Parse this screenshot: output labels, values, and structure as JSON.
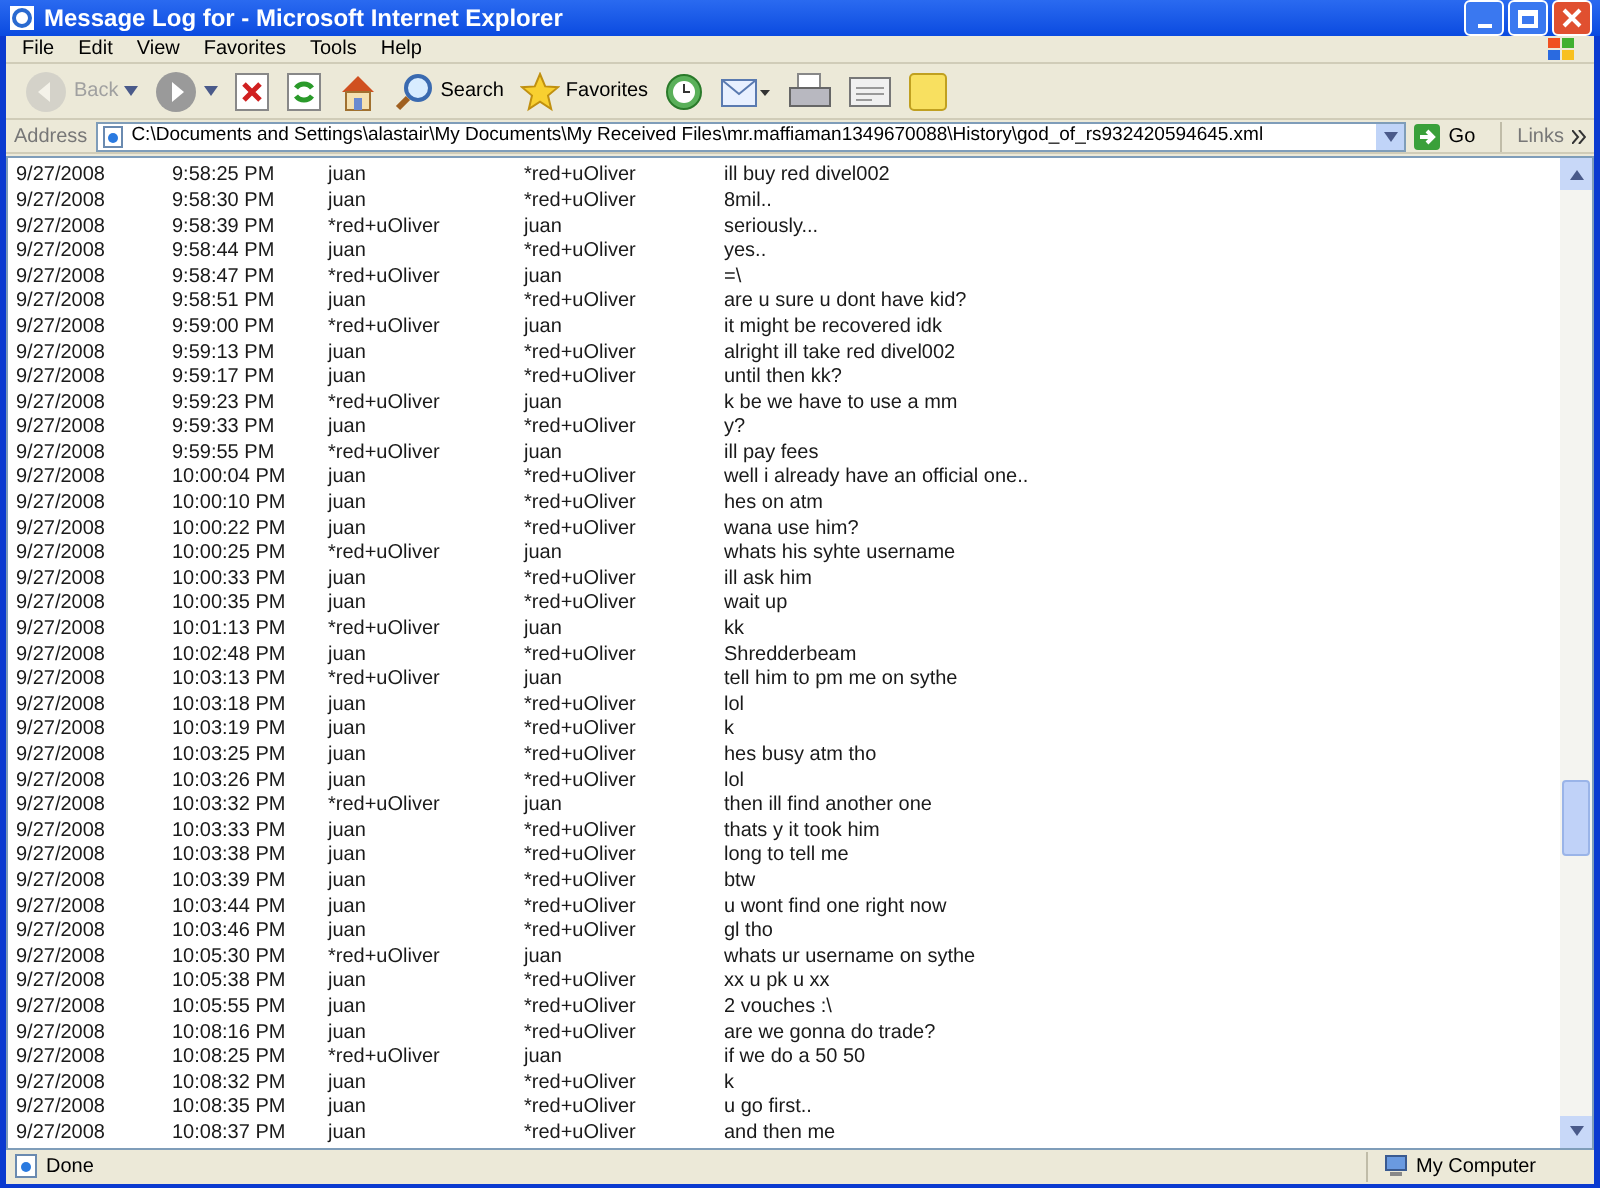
{
  "window": {
    "title": "Message Log for - Microsoft Internet Explorer"
  },
  "menu": [
    "File",
    "Edit",
    "View",
    "Favorites",
    "Tools",
    "Help"
  ],
  "toolbar": [
    {
      "kind": "back",
      "label": "Back",
      "disabled": true
    },
    {
      "kind": "forward",
      "disabled": false
    },
    {
      "kind": "stop"
    },
    {
      "kind": "refresh"
    },
    {
      "kind": "home"
    },
    {
      "kind": "search",
      "label": "Search"
    },
    {
      "kind": "favorites",
      "label": "Favorites"
    },
    {
      "kind": "history"
    },
    {
      "kind": "mail"
    },
    {
      "kind": "print"
    },
    {
      "kind": "edit"
    },
    {
      "kind": "note"
    }
  ],
  "address": {
    "label": "Address",
    "value": "C:\\Documents and Settings\\alastair\\My Documents\\My Received Files\\mr.maffiaman1349670088\\History\\god_of_rs932420594645.xml",
    "go": "Go",
    "links": "Links"
  },
  "rows": [
    {
      "date": "9/27/2008",
      "time": "9:58:25 PM",
      "from": "juan",
      "to": "*red+uOliver",
      "message": "ill buy red divel002"
    },
    {
      "date": "9/27/2008",
      "time": "9:58:30 PM",
      "from": "juan",
      "to": "*red+uOliver",
      "message": "8mil.."
    },
    {
      "date": "9/27/2008",
      "time": "9:58:39 PM",
      "from": "*red+uOliver",
      "to": "juan",
      "message": "seriously..."
    },
    {
      "date": "9/27/2008",
      "time": "9:58:44 PM",
      "from": "juan",
      "to": "*red+uOliver",
      "message": "yes.."
    },
    {
      "date": "9/27/2008",
      "time": "9:58:47 PM",
      "from": "*red+uOliver",
      "to": "juan",
      "message": "=\\"
    },
    {
      "date": "9/27/2008",
      "time": "9:58:51 PM",
      "from": "juan",
      "to": "*red+uOliver",
      "message": "are u sure u dont have kid?"
    },
    {
      "date": "9/27/2008",
      "time": "9:59:00 PM",
      "from": "*red+uOliver",
      "to": "juan",
      "message": "it might be recovered idk"
    },
    {
      "date": "9/27/2008",
      "time": "9:59:13 PM",
      "from": "juan",
      "to": "*red+uOliver",
      "message": "alright ill take red divel002"
    },
    {
      "date": "9/27/2008",
      "time": "9:59:17 PM",
      "from": "juan",
      "to": "*red+uOliver",
      "message": "until then kk?"
    },
    {
      "date": "9/27/2008",
      "time": "9:59:23 PM",
      "from": "*red+uOliver",
      "to": "juan",
      "message": "k be we have to use a mm"
    },
    {
      "date": "9/27/2008",
      "time": "9:59:33 PM",
      "from": "juan",
      "to": "*red+uOliver",
      "message": "y?"
    },
    {
      "date": "9/27/2008",
      "time": "9:59:55 PM",
      "from": "*red+uOliver",
      "to": "juan",
      "message": "ill pay fees"
    },
    {
      "date": "9/27/2008",
      "time": "10:00:04 PM",
      "from": "juan",
      "to": "*red+uOliver",
      "message": "well i already have an official one.."
    },
    {
      "date": "9/27/2008",
      "time": "10:00:10 PM",
      "from": "juan",
      "to": "*red+uOliver",
      "message": "hes on atm"
    },
    {
      "date": "9/27/2008",
      "time": "10:00:22 PM",
      "from": "juan",
      "to": "*red+uOliver",
      "message": "wana use him?"
    },
    {
      "date": "9/27/2008",
      "time": "10:00:25 PM",
      "from": "*red+uOliver",
      "to": "juan",
      "message": "whats his syhte username"
    },
    {
      "date": "9/27/2008",
      "time": "10:00:33 PM",
      "from": "juan",
      "to": "*red+uOliver",
      "message": "ill ask him"
    },
    {
      "date": "9/27/2008",
      "time": "10:00:35 PM",
      "from": "juan",
      "to": "*red+uOliver",
      "message": "wait up"
    },
    {
      "date": "9/27/2008",
      "time": "10:01:13 PM",
      "from": "*red+uOliver",
      "to": "juan",
      "message": "kk"
    },
    {
      "date": "9/27/2008",
      "time": "10:02:48 PM",
      "from": "juan",
      "to": "*red+uOliver",
      "message": "Shredderbeam"
    },
    {
      "date": "9/27/2008",
      "time": "10:03:13 PM",
      "from": "*red+uOliver",
      "to": "juan",
      "message": "tell him to pm me on sythe"
    },
    {
      "date": "9/27/2008",
      "time": "10:03:18 PM",
      "from": "juan",
      "to": "*red+uOliver",
      "message": "lol"
    },
    {
      "date": "9/27/2008",
      "time": "10:03:19 PM",
      "from": "juan",
      "to": "*red+uOliver",
      "message": "k"
    },
    {
      "date": "9/27/2008",
      "time": "10:03:25 PM",
      "from": "juan",
      "to": "*red+uOliver",
      "message": "hes busy atm tho"
    },
    {
      "date": "9/27/2008",
      "time": "10:03:26 PM",
      "from": "juan",
      "to": "*red+uOliver",
      "message": "lol"
    },
    {
      "date": "9/27/2008",
      "time": "10:03:32 PM",
      "from": "*red+uOliver",
      "to": "juan",
      "message": "then ill find another one"
    },
    {
      "date": "9/27/2008",
      "time": "10:03:33 PM",
      "from": "juan",
      "to": "*red+uOliver",
      "message": "thats y it took him"
    },
    {
      "date": "9/27/2008",
      "time": "10:03:38 PM",
      "from": "juan",
      "to": "*red+uOliver",
      "message": "long to tell me"
    },
    {
      "date": "9/27/2008",
      "time": "10:03:39 PM",
      "from": "juan",
      "to": "*red+uOliver",
      "message": "btw"
    },
    {
      "date": "9/27/2008",
      "time": "10:03:44 PM",
      "from": "juan",
      "to": "*red+uOliver",
      "message": "u wont find one right now"
    },
    {
      "date": "9/27/2008",
      "time": "10:03:46 PM",
      "from": "juan",
      "to": "*red+uOliver",
      "message": "gl tho"
    },
    {
      "date": "9/27/2008",
      "time": "10:05:30 PM",
      "from": "*red+uOliver",
      "to": "juan",
      "message": "whats ur username on sythe"
    },
    {
      "date": "9/27/2008",
      "time": "10:05:38 PM",
      "from": "juan",
      "to": "*red+uOliver",
      "message": "xx u pk u xx"
    },
    {
      "date": "9/27/2008",
      "time": "10:05:55 PM",
      "from": "juan",
      "to": "*red+uOliver",
      "message": "2 vouches :\\"
    },
    {
      "date": "9/27/2008",
      "time": "10:08:16 PM",
      "from": "juan",
      "to": "*red+uOliver",
      "message": "are we gonna do trade?"
    },
    {
      "date": "9/27/2008",
      "time": "10:08:25 PM",
      "from": "*red+uOliver",
      "to": "juan",
      "message": "if we do a 50 50"
    },
    {
      "date": "9/27/2008",
      "time": "10:08:32 PM",
      "from": "juan",
      "to": "*red+uOliver",
      "message": "k"
    },
    {
      "date": "9/27/2008",
      "time": "10:08:35 PM",
      "from": "juan",
      "to": "*red+uOliver",
      "message": "u go first.."
    },
    {
      "date": "9/27/2008",
      "time": "10:08:37 PM",
      "from": "juan",
      "to": "*red+uOliver",
      "message": "and then me"
    }
  ],
  "status_bar": {
    "text": "Done",
    "zone": "My Computer"
  }
}
